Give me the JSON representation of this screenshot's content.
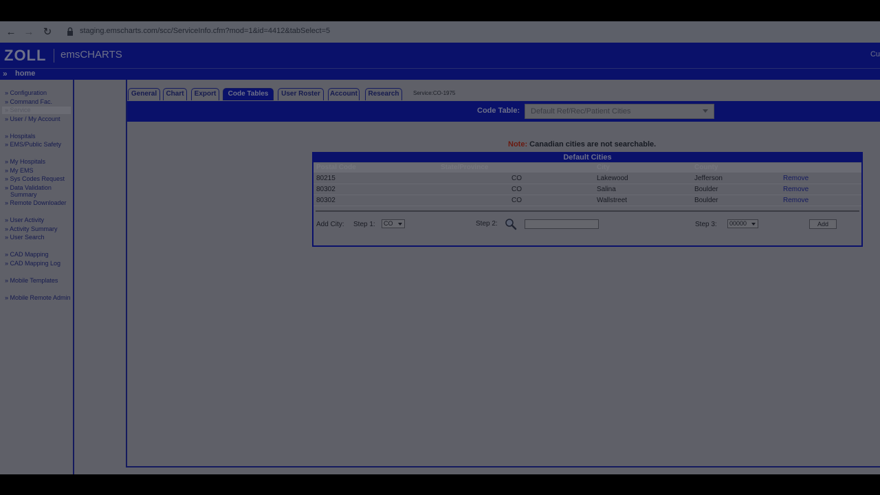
{
  "browser": {
    "url": "staging.emscharts.com/scc/ServiceInfo.cfm?mod=1&id=4412&tabSelect=5"
  },
  "header": {
    "logo_brand": "ZOLL",
    "logo_product": "emsCHARTS",
    "right_text": "Cu"
  },
  "home": {
    "label": "home"
  },
  "sidebar": {
    "items": [
      {
        "label": "» Configuration"
      },
      {
        "label": "» Command Fac."
      },
      {
        "label": "» Service"
      },
      {
        "label": "» User / My Account"
      },
      {
        "label": "» Hospitals"
      },
      {
        "label": "» EMS/Public Safety"
      },
      {
        "label": "» My Hospitals"
      },
      {
        "label": "» My EMS"
      },
      {
        "label": "» Sys Codes Request"
      },
      {
        "label": "» Data Validation"
      },
      {
        "label": "Summary"
      },
      {
        "label": "» Remote Downloader"
      },
      {
        "label": "» User Activity"
      },
      {
        "label": "» Activity Summary"
      },
      {
        "label": "» User Search"
      },
      {
        "label": "» CAD Mapping"
      },
      {
        "label": "» CAD Mapping Log"
      },
      {
        "label": "» Mobile Templates"
      },
      {
        "label": "» Mobile Remote Admin"
      }
    ]
  },
  "tabs": [
    {
      "label": "General"
    },
    {
      "label": "Chart"
    },
    {
      "label": "Export"
    },
    {
      "label": "Code Tables"
    },
    {
      "label": "User Roster"
    },
    {
      "label": "Account"
    },
    {
      "label": "Research"
    }
  ],
  "service_id": "Service:CO-1975",
  "code_table": {
    "label": "Code Table:",
    "selected": "Default Ref/Rec/Patient Cities"
  },
  "note": {
    "prefix": "Note:",
    "text": "Canadian cities are not searchable."
  },
  "cities": {
    "title": "Default Cities",
    "columns": [
      "Postal Code",
      "State/Province",
      "City",
      "County"
    ],
    "rows": [
      {
        "postal": "80215",
        "state": "CO",
        "city": "Lakewood",
        "county": "Jefferson",
        "action": "Remove"
      },
      {
        "postal": "80302",
        "state": "CO",
        "city": "Salina",
        "county": "Boulder",
        "action": "Remove"
      },
      {
        "postal": "80302",
        "state": "CO",
        "city": "Wallstreet",
        "county": "Boulder",
        "action": "Remove"
      }
    ]
  },
  "add_city": {
    "label": "Add City:",
    "step1_label": "Step 1:",
    "step1_value": "CO",
    "step2_label": "Step 2:",
    "step2_value": "",
    "step3_label": "Step 3:",
    "step3_value": "00000",
    "add_button": "Add"
  }
}
